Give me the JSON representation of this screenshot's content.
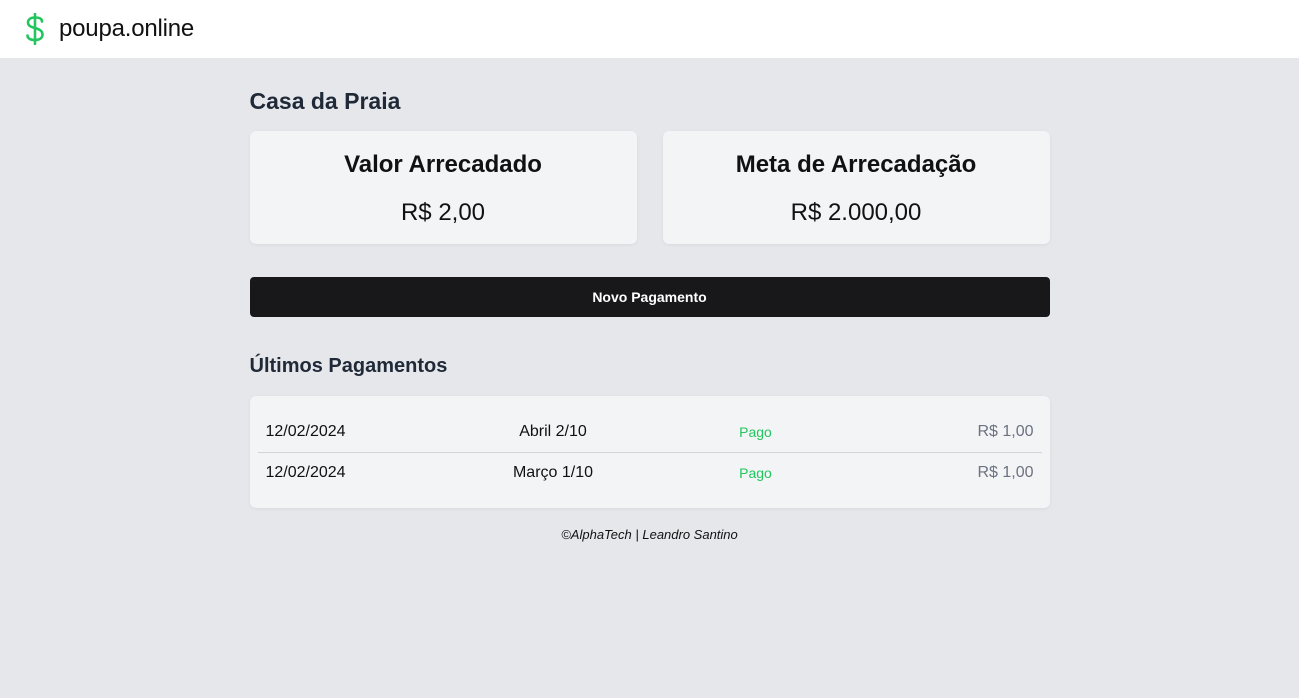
{
  "app": {
    "name": "poupa.online",
    "logo_icon": "dollar-icon",
    "accent_color": "#22c55e"
  },
  "project": {
    "title": "Casa da Praia"
  },
  "cards": [
    {
      "title": "Valor Arrecadado",
      "value": "R$ 2,00"
    },
    {
      "title": "Meta de Arrecadação",
      "value": "R$ 2.000,00"
    }
  ],
  "actions": {
    "new_payment_label": "Novo Pagamento"
  },
  "payments": {
    "title": "Últimos Pagamentos",
    "rows": [
      {
        "date": "12/02/2024",
        "description": "Abril 2/10",
        "status": "Pago",
        "amount": "R$ 1,00"
      },
      {
        "date": "12/02/2024",
        "description": "Março 1/10",
        "status": "Pago",
        "amount": "R$ 1,00"
      }
    ]
  },
  "footer": {
    "text": "©AlphaTech | Leandro Santino"
  }
}
